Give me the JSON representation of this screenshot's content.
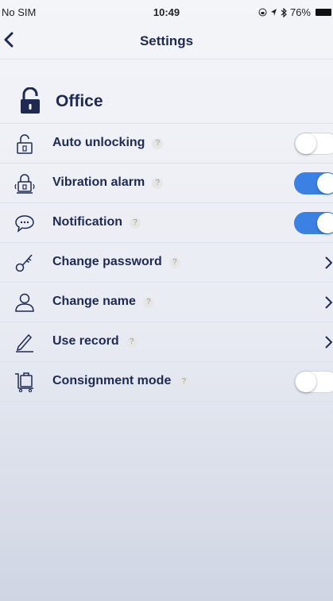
{
  "status_bar": {
    "carrier": "No SIM",
    "time": "10:49",
    "battery": "76%"
  },
  "nav": {
    "title": "Settings",
    "back_icon": "chevron-left-icon"
  },
  "lock": {
    "name": "Office",
    "icon": "lock-icon"
  },
  "help_mark": "?",
  "settings": [
    {
      "label": "Auto unlocking",
      "icon": "unlock-icon",
      "control": "toggle",
      "enabled": false
    },
    {
      "label": "Vibration alarm",
      "icon": "vibration-lock-icon",
      "control": "toggle",
      "enabled": true
    },
    {
      "label": "Notification",
      "icon": "chat-bubble-icon",
      "control": "toggle",
      "enabled": true
    },
    {
      "label": "Change password",
      "icon": "key-icon",
      "control": "chevron"
    },
    {
      "label": "Change name",
      "icon": "person-icon",
      "control": "chevron"
    },
    {
      "label": "Use record",
      "icon": "pen-icon",
      "control": "chevron"
    },
    {
      "label": "Consignment mode",
      "icon": "cart-icon",
      "control": "toggle",
      "enabled": false
    }
  ],
  "colors": {
    "accent": "#3b81e3",
    "text": "#1f2a52"
  }
}
